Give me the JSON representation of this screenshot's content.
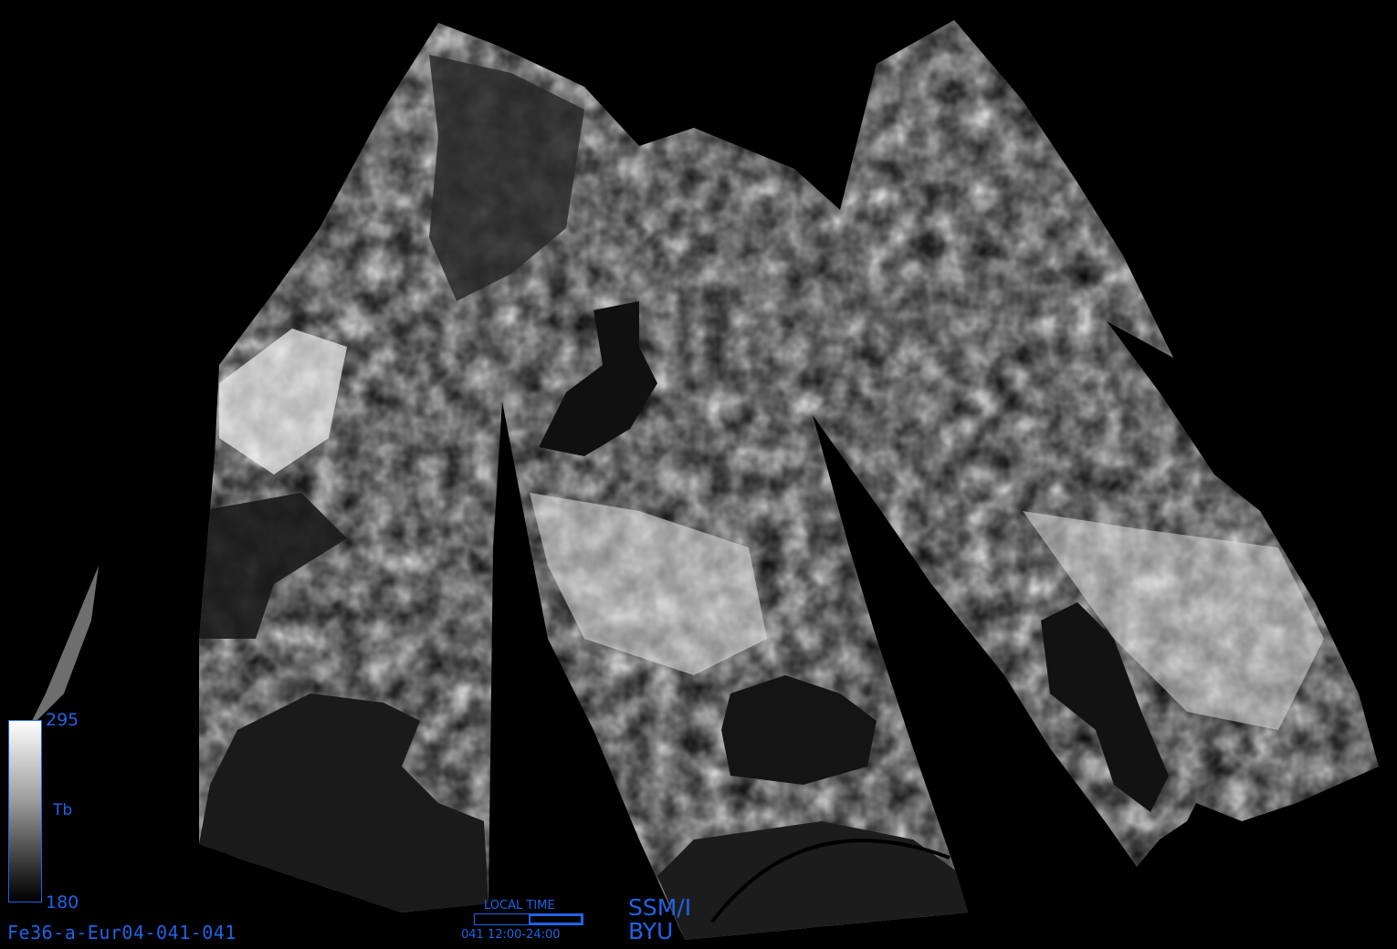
{
  "image": {
    "kind": "SSM/I brightness temperature mosaic (grayscale)",
    "width": 1530,
    "height": 1040
  },
  "colorbar": {
    "max_label": "295",
    "min_label": "180",
    "variable_label": "Tb",
    "min_value": 180,
    "max_value": 295,
    "border_color": "#1f63e6"
  },
  "annotations": {
    "filename": "Fe36-a-Eur04-041-041",
    "local_time_title": "LOCAL TIME",
    "local_time_range": "041 12:00-24:00",
    "local_time_fraction_start": 0.5,
    "local_time_fraction_end": 1.0,
    "sensor": "SSM/I",
    "organization": "BYU"
  },
  "colors": {
    "background": "#000000",
    "label_blue": "#1f63e6",
    "swath_light": "#d4d4d4",
    "swath_mid": "#9a9a9a",
    "sea_dark": "#151515"
  }
}
